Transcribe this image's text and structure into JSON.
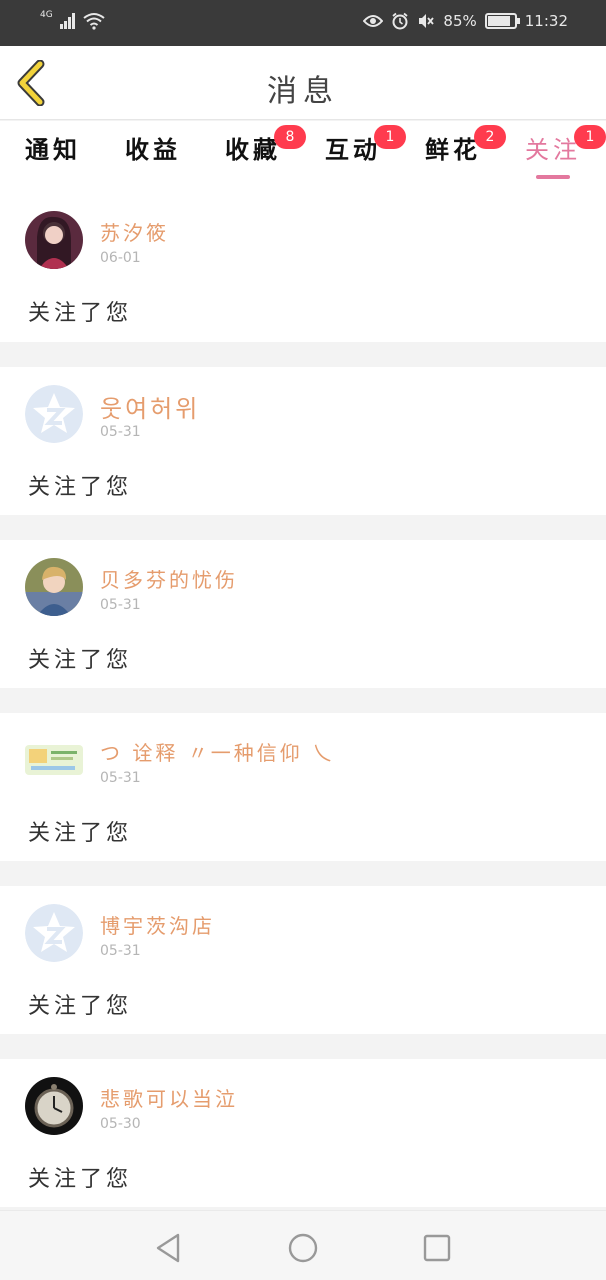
{
  "status_bar": {
    "network": "4G",
    "battery": "85%",
    "battery_level": 0.85,
    "time": "11:32",
    "icons": [
      "signal-icon",
      "wifi-icon",
      "eye-icon",
      "alarm-icon",
      "mute-icon",
      "battery-icon"
    ]
  },
  "header": {
    "title": "消息",
    "back_icon": "chevron-left-icon"
  },
  "tabs": [
    {
      "label": "通知",
      "badge": ""
    },
    {
      "label": "收益",
      "badge": ""
    },
    {
      "label": "收藏",
      "badge": "8"
    },
    {
      "label": "互动",
      "badge": "1"
    },
    {
      "label": "鲜花",
      "badge": "2"
    },
    {
      "label": "关注",
      "badge": "1"
    }
  ],
  "active_tab": "关注",
  "items": [
    {
      "name": "苏汐筱",
      "date": "06-01",
      "message": "关注了您",
      "avatar": "girl-portrait"
    },
    {
      "name": "웃여허위",
      "date": "05-31",
      "message": "关注了您",
      "avatar": "default-qzone"
    },
    {
      "name": "贝多芬的忧伤",
      "date": "05-31",
      "message": "关注了您",
      "avatar": "boy-portrait"
    },
    {
      "name": "つ 诠释 〃一种信仰 乀",
      "date": "05-31",
      "message": "关注了您",
      "avatar": "banner-image"
    },
    {
      "name": "博宇茨沟店",
      "date": "05-31",
      "message": "关注了您",
      "avatar": "default-qzone"
    },
    {
      "name": "悲歌可以当泣",
      "date": "05-30",
      "message": "关注了您",
      "avatar": "pocket-watch"
    }
  ],
  "nav": [
    "back-triangle-icon",
    "home-circle-icon",
    "recents-square-icon"
  ],
  "colors": {
    "accent": "#e3789e",
    "name": "#e59c6d",
    "badge": "#ff3b4e",
    "back": "#f2d33b"
  }
}
